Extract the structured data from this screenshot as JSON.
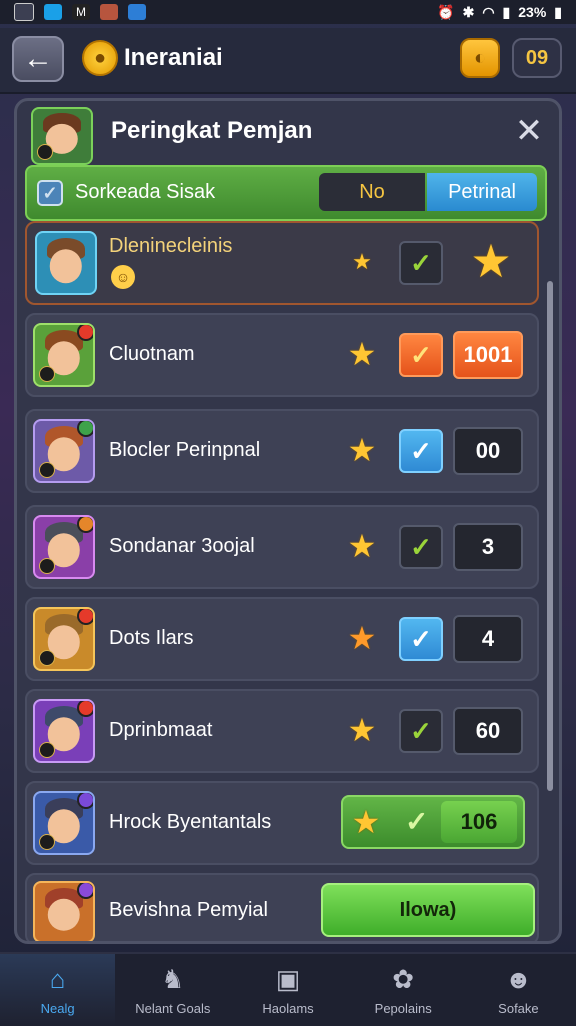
{
  "status_bar": {
    "time_text": "23%",
    "icons": [
      "gallery-icon",
      "browser-icon",
      "app-icon",
      "photo-icon",
      "facebook-icon",
      "alarm-icon",
      "bluetooth-icon",
      "wifi-icon",
      "signal-icon",
      "battery-icon"
    ]
  },
  "header": {
    "title": "Ineraniai",
    "coin_glyph": "●",
    "back_glyph": "←",
    "gold_glyph": "◐",
    "count": "09"
  },
  "panel": {
    "title": "Peringkat Pemjan",
    "close_glyph": "✕",
    "toggle": {
      "label": "Sorkeada Sisak",
      "no_label": "No",
      "yes_label": "Petrinal",
      "check": "✓"
    },
    "rows": [
      {
        "name": "Dleninecleinis",
        "star": "★",
        "check": "✓",
        "value": "",
        "emoji": "☺"
      },
      {
        "name": "Cluotnam",
        "star": "★",
        "check": "✓",
        "value": "1001"
      },
      {
        "name": "Blocler Perinpnal",
        "star": "★",
        "check": "✓",
        "value": "00"
      },
      {
        "name": "Sondanar 3oojal",
        "star": "★",
        "check": "✓",
        "value": "3"
      },
      {
        "name": "Dots Ilars",
        "star": "★",
        "check": "✓",
        "value": "4"
      },
      {
        "name": "Dprinbmaat",
        "star": "★",
        "check": "✓",
        "value": "60"
      },
      {
        "name": "Hrock Byentantals",
        "star": "★",
        "check": "✓",
        "value": "106"
      },
      {
        "name": "Bevishna Pemyial",
        "button_label": "Ilowa)"
      }
    ]
  },
  "nav": [
    {
      "label": "Nealg",
      "icon": "⌂"
    },
    {
      "label": "Nelant Goals",
      "icon": "♞"
    },
    {
      "label": "Haolams",
      "icon": "▣"
    },
    {
      "label": "Pepolains",
      "icon": "✿"
    },
    {
      "label": "Sofake",
      "icon": "☻"
    }
  ],
  "colors": {
    "accent": "#4aa9f0",
    "green": "#5fae45",
    "orange": "#e5531b",
    "gold": "#ffc633"
  }
}
